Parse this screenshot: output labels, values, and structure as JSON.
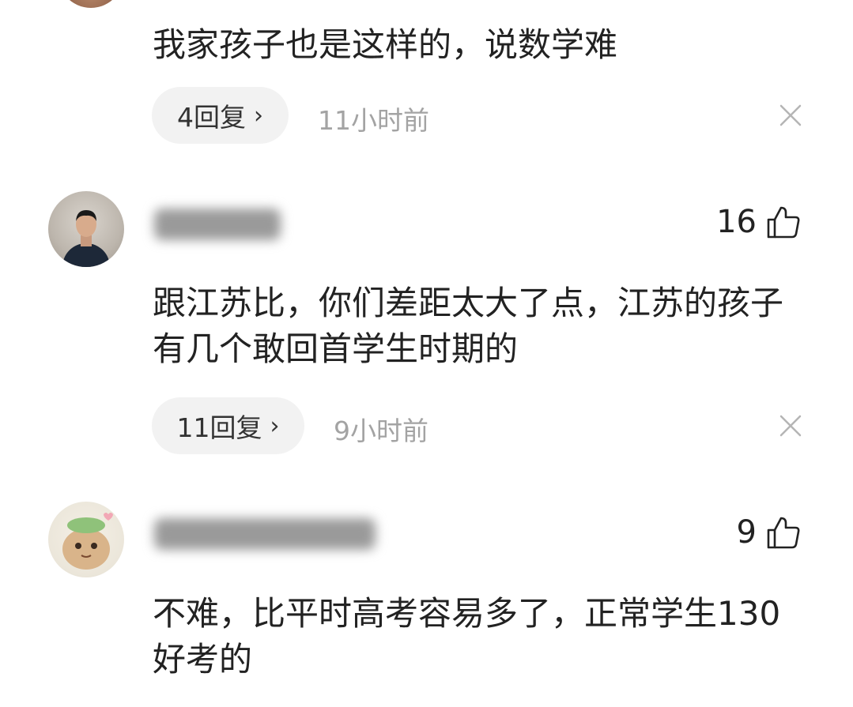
{
  "comments": [
    {
      "text": "我家孩子也是这样的，说数学难",
      "reply_label": "4回复",
      "time": "11小时前"
    },
    {
      "text": "跟江苏比，你们差距太大了点，江苏的孩子有几个敢回首学生时期的",
      "likes": "16",
      "reply_label": "11回复",
      "time": "9小时前"
    },
    {
      "text": "不难，比平时高考容易多了，正常学生130好考的",
      "likes": "9"
    }
  ],
  "icons": {
    "reply_chevron": "chevron-right-icon",
    "dismiss": "close-icon",
    "like": "thumbs-up-icon"
  },
  "colors": {
    "pill_background": "#f2f2f2",
    "timestamp_gray": "#a3a3a3",
    "text_primary": "#222222"
  }
}
